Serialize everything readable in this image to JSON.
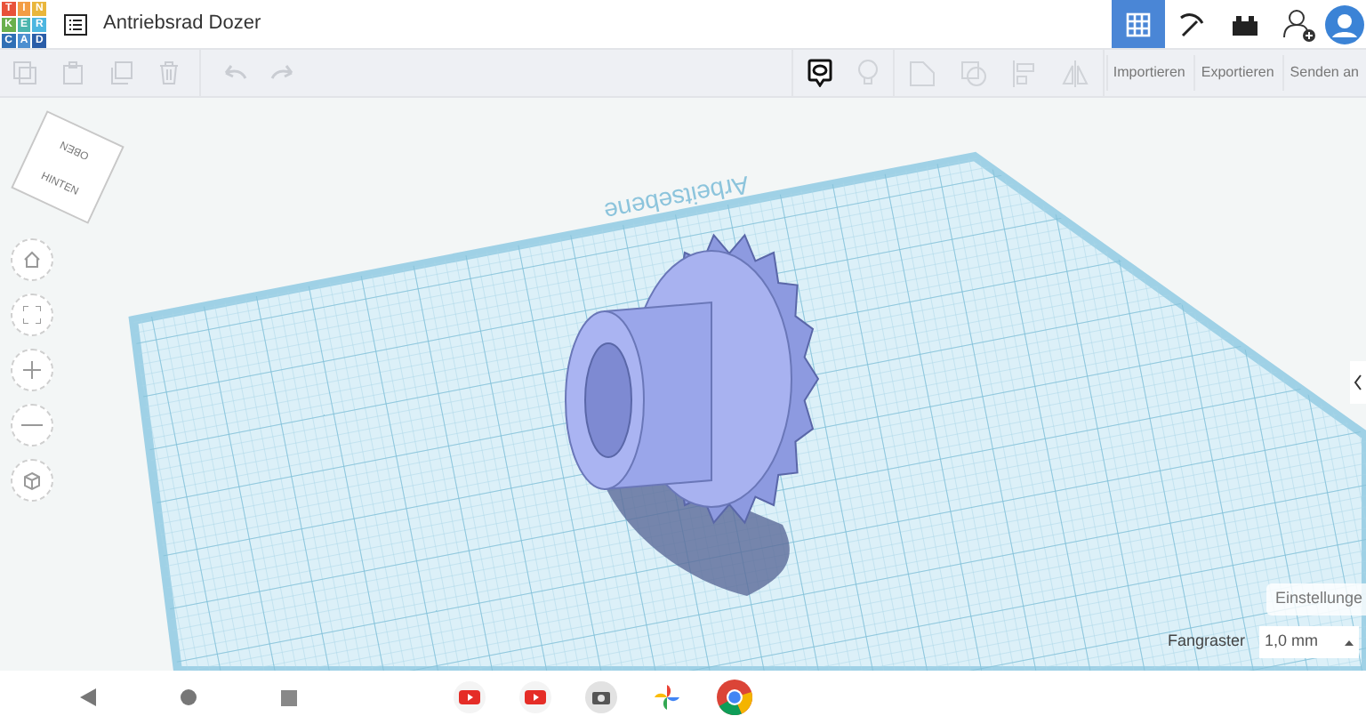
{
  "header": {
    "logo_letters": [
      "T",
      "I",
      "N",
      "K",
      "E",
      "R",
      "C",
      "A",
      "D"
    ],
    "title": "Antriebsrad Dozer",
    "view_modes": [
      {
        "kind": "grid",
        "selected": true
      },
      {
        "kind": "pickaxe",
        "selected": false
      },
      {
        "kind": "bricks",
        "selected": false
      }
    ]
  },
  "toolbar": {
    "buttons": [
      "Importieren",
      "Exportieren",
      "Senden an"
    ]
  },
  "view_cube": {
    "faces": [
      "OBEN",
      "HINTEN"
    ]
  },
  "workplane": {
    "label": "Arbeitsebene"
  },
  "settings_button": "Einstellunge",
  "snap_grid": {
    "label": "Fangraster",
    "value": "1,0 mm"
  }
}
